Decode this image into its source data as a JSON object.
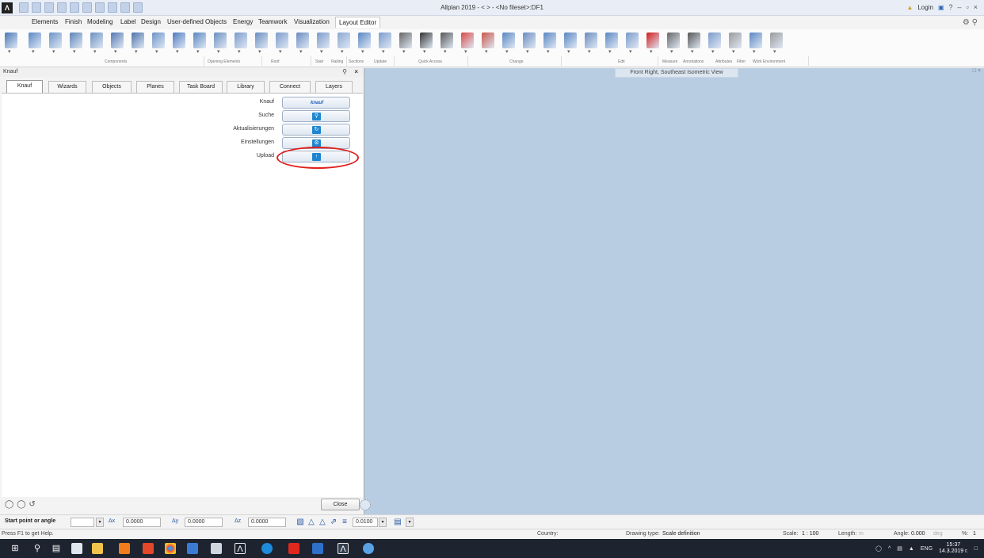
{
  "window": {
    "app_logo": "Λ",
    "title": "Allplan 2019 - <   > - <No fileset>:DF1",
    "login": "Login",
    "controls": [
      "?",
      "–",
      "▫",
      "×"
    ]
  },
  "ribbon_tabs": [
    "Elements",
    "Finish",
    "Modeling",
    "Label",
    "Design",
    "User-defined Objects",
    "Energy",
    "Teamwork",
    "Visualization",
    "Layout Editor"
  ],
  "ribbon_active_tab": "Layout Editor",
  "ribbon_groups": [
    "Components",
    "Opening Elements",
    "Roof",
    "Stair",
    "Railing",
    "Sections",
    "Update",
    "Quick Access",
    "Change",
    "Edit",
    "Measure",
    "Annotations",
    "Attributes",
    "Filter",
    "Work Environment"
  ],
  "ribbon_icons": [
    {
      "name": "wall-icon",
      "color": "#4a77b8"
    },
    {
      "name": "slab-icon",
      "color": "#5b86c4"
    },
    {
      "name": "column-icon",
      "color": "#6c93c8"
    },
    {
      "name": "upstand-icon",
      "color": "#5c83b8"
    },
    {
      "name": "beam-icon",
      "color": "#6a8fc0"
    },
    {
      "name": "window-icon",
      "color": "#5578b0"
    },
    {
      "name": "stair-icon",
      "color": "#4d72a8"
    },
    {
      "name": "opening-icon",
      "color": "#6c93c8"
    },
    {
      "name": "smartpart-icon",
      "color": "#4d7ac0"
    },
    {
      "name": "fixture-icon",
      "color": "#5a86c2"
    },
    {
      "name": "door-icon",
      "color": "#6a8fbe"
    },
    {
      "name": "grid-icon",
      "color": "#7a9acb"
    },
    {
      "name": "roof-icon",
      "color": "#6b8cc0"
    },
    {
      "name": "dormer-icon",
      "color": "#7a9acb"
    },
    {
      "name": "skylight-icon",
      "color": "#6b8cc0"
    },
    {
      "name": "stair-tool-icon",
      "color": "#7a9acb"
    },
    {
      "name": "railing-icon",
      "color": "#8aa7d0"
    },
    {
      "name": "section-icon",
      "color": "#5a86c2"
    },
    {
      "name": "update-icon",
      "color": "#7a9acb"
    },
    {
      "name": "line-icon",
      "color": "#666666"
    },
    {
      "name": "text-icon",
      "color": "#333333"
    },
    {
      "name": "dimension-icon",
      "color": "#555555"
    },
    {
      "name": "modify-icon",
      "color": "#d84a4a"
    },
    {
      "name": "stretch-icon",
      "color": "#c8564a"
    },
    {
      "name": "copy-icon",
      "color": "#5a86c2"
    },
    {
      "name": "curve-icon",
      "color": "#6b8cc0"
    },
    {
      "name": "join-icon",
      "color": "#5a86c2"
    },
    {
      "name": "move-icon",
      "color": "#5a86c2"
    },
    {
      "name": "mirror-icon",
      "color": "#6b8cc0"
    },
    {
      "name": "trim-icon",
      "color": "#5a86c2"
    },
    {
      "name": "offset-icon",
      "color": "#7a9acb"
    },
    {
      "name": "delete-icon",
      "color": "#d01c1c"
    },
    {
      "name": "measure-icon",
      "color": "#666666"
    },
    {
      "name": "label-icon",
      "color": "#555555"
    },
    {
      "name": "attribute-icon",
      "color": "#7a9acb"
    },
    {
      "name": "filter-icon",
      "color": "#999999"
    },
    {
      "name": "environment-icon",
      "color": "#5a86c2"
    },
    {
      "name": "layout-icon",
      "color": "#999999"
    }
  ],
  "panel": {
    "title": "Knauf",
    "pin": "⚲",
    "close": "×",
    "tabs": [
      "Knauf",
      "Wizards",
      "Objects",
      "Planes",
      "Task Board",
      "Library",
      "Connect",
      "Layers"
    ],
    "active_tab": "Knauf",
    "rows": [
      {
        "label": "Knauf",
        "icon": "knauf-logo-icon"
      },
      {
        "label": "Suche",
        "icon": "search-icon"
      },
      {
        "label": "Aktualisierungen",
        "icon": "update-icon"
      },
      {
        "label": "Einstellungen",
        "icon": "settings-icon"
      },
      {
        "label": "Upload",
        "icon": "upload-icon"
      }
    ],
    "knauf_logo_text": "knauf",
    "close_button": "Close"
  },
  "viewport": {
    "view_label": "Front Right, Southeast Isometric View",
    "background": "#b8cce2"
  },
  "dialog_line": {
    "prompt": "Start point or angle",
    "dx_label": "Δx",
    "dx_value": "0.0000",
    "dy_label": "Δy",
    "dy_value": "0.0000",
    "dz_label": "Δz",
    "dz_value": "0.0000",
    "tolerance": "0.0100"
  },
  "status": {
    "help": "Press F1 to get Help.",
    "country_label": "Country:",
    "drawing_type_label": "Drawing type:",
    "drawing_type_value": "Scale definition",
    "scale_label": "Scale:",
    "scale_value": "1 : 100",
    "length_label": "Length:",
    "length_unit": "m",
    "angle_label": "Angle:",
    "angle_value": "0.000",
    "angle_unit": "deg",
    "percent_label": "%:",
    "percent_value": "1"
  },
  "taskbar": {
    "lang": "ENG",
    "time": "15:37",
    "date": "14.3.2019 г."
  }
}
